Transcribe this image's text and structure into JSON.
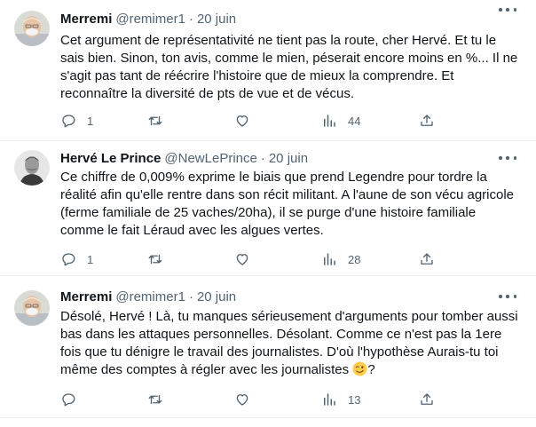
{
  "tweets": [
    {
      "name": "Merremi",
      "handle": "@remimer1",
      "separator": "·",
      "date": "20 juin",
      "avatar": "avatar-elderly-man",
      "text": "Cet argument de représentativité ne tient pas la route, cher Hervé. Et tu le sais bien. Sinon, ton avis, comme le mien, péserait encore moins en %... Il ne s'agit pas tant de réécrire l'histoire que de mieux la comprendre. Et reconnaître la diversité de pts de vue et de vécus.",
      "replies": "1",
      "retweets": "",
      "likes": "",
      "views": "44"
    },
    {
      "name": "Hervé Le Prince",
      "handle": "@NewLePrince",
      "separator": "·",
      "date": "20 juin",
      "avatar": "avatar-man-bw",
      "text": "Ce chiffre de 0,009% exprime le biais que prend Legendre pour tordre la réalité afin qu'elle rentre dans son récit militant. A l'aune de son vécu agricole (ferme familiale de 25 vaches/20ha), il se purge d'une histoire familiale comme le fait Léraud avec les algues vertes.",
      "replies": "1",
      "retweets": "",
      "likes": "",
      "views": "28"
    },
    {
      "name": "Merremi",
      "handle": "@remimer1",
      "separator": "·",
      "date": "20 juin",
      "avatar": "avatar-elderly-man",
      "text": "Désolé, Hervé ! Là, tu manques sérieusement d'arguments pour tomber aussi bas dans les attaques personnelles. Désolant. Comme ce n'est pas la 1ere fois que tu dénigre le travail des journalistes. D'où l'hypothèse Aurais-tu toi même des comptes à régler avec les journalistes",
      "emoji": "winking-face-emoji",
      "text_end": "?",
      "replies": "",
      "retweets": "",
      "likes": "",
      "views": "13"
    }
  ],
  "colors": {
    "text": "#0f1419",
    "muted": "#536471",
    "divider": "#eff3f4",
    "emoji": "#ffcc4d"
  }
}
